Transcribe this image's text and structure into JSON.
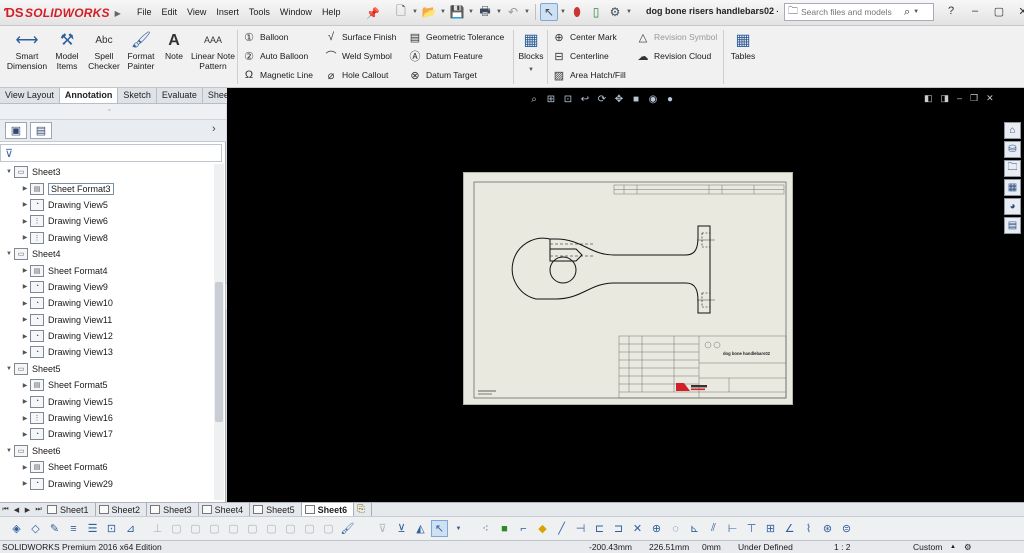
{
  "app": {
    "brand": "SOLIDWORKS",
    "doc_title": "dog bone risers handlebars02 - S..."
  },
  "menus": [
    "File",
    "Edit",
    "View",
    "Insert",
    "Tools",
    "Window",
    "Help"
  ],
  "search": {
    "placeholder": "Search files and models"
  },
  "ribbon": {
    "smart_dimension": "Smart Dimension",
    "model_items": "Model Items",
    "spell_checker": "Spell Checker",
    "format_painter": "Format Painter",
    "note": "Note",
    "linear_note_pattern": "Linear Note Pattern",
    "balloon": "Balloon",
    "auto_balloon": "Auto Balloon",
    "magnetic_line": "Magnetic Line",
    "surface_finish": "Surface Finish",
    "weld_symbol": "Weld Symbol",
    "hole_callout": "Hole Callout",
    "geometric_tolerance": "Geometric Tolerance",
    "datum_feature": "Datum Feature",
    "datum_target": "Datum Target",
    "blocks": "Blocks",
    "center_mark": "Center Mark",
    "centerline": "Centerline",
    "area_hatch_fill": "Area Hatch/Fill",
    "revision_symbol": "Revision Symbol",
    "revision_cloud": "Revision Cloud",
    "tables": "Tables"
  },
  "cm_tabs": [
    {
      "label": "View Layout",
      "active": false
    },
    {
      "label": "Annotation",
      "active": true
    },
    {
      "label": "Sketch",
      "active": false
    },
    {
      "label": "Evaluate",
      "active": false
    },
    {
      "label": "Sheet Format",
      "active": false
    }
  ],
  "tree": [
    {
      "label": "Sheet3",
      "level": 0,
      "icon": "sheet-icon"
    },
    {
      "label": "Sheet Format3",
      "level": 1,
      "icon": "sheet-format-icon",
      "selected": true
    },
    {
      "label": "Drawing View5",
      "level": 1,
      "icon": "drawing-view-icon"
    },
    {
      "label": "Drawing View6",
      "level": 1,
      "icon": "section-view-icon"
    },
    {
      "label": "Drawing View8",
      "level": 1,
      "icon": "section-view-icon"
    },
    {
      "label": "Sheet4",
      "level": 0,
      "icon": "sheet-icon"
    },
    {
      "label": "Sheet Format4",
      "level": 1,
      "icon": "sheet-format-icon"
    },
    {
      "label": "Drawing View9",
      "level": 1,
      "icon": "drawing-view-icon"
    },
    {
      "label": "Drawing View10",
      "level": 1,
      "icon": "drawing-view-icon"
    },
    {
      "label": "Drawing View11",
      "level": 1,
      "icon": "drawing-view-icon"
    },
    {
      "label": "Drawing View12",
      "level": 1,
      "icon": "drawing-view-icon"
    },
    {
      "label": "Drawing View13",
      "level": 1,
      "icon": "drawing-view-icon"
    },
    {
      "label": "Sheet5",
      "level": 0,
      "icon": "sheet-icon"
    },
    {
      "label": "Sheet Format5",
      "level": 1,
      "icon": "sheet-format-icon"
    },
    {
      "label": "Drawing View15",
      "level": 1,
      "icon": "drawing-view-icon"
    },
    {
      "label": "Drawing View16",
      "level": 1,
      "icon": "section-view-icon"
    },
    {
      "label": "Drawing View17",
      "level": 1,
      "icon": "drawing-view-icon"
    },
    {
      "label": "Sheet6",
      "level": 0,
      "icon": "sheet-icon"
    },
    {
      "label": "Sheet Format6",
      "level": 1,
      "icon": "sheet-format-icon"
    },
    {
      "label": "Drawing View29",
      "level": 1,
      "icon": "drawing-view-icon"
    }
  ],
  "sheet_tabs": [
    {
      "label": "Sheet1",
      "active": false
    },
    {
      "label": "Sheet2",
      "active": false
    },
    {
      "label": "Sheet3",
      "active": false
    },
    {
      "label": "Sheet4",
      "active": false
    },
    {
      "label": "Sheet5",
      "active": false
    },
    {
      "label": "Sheet6",
      "active": true
    }
  ],
  "drawing": {
    "title_block_name": "dog bone handlebars02"
  },
  "status": {
    "edition": "SOLIDWORKS Premium 2016 x64 Edition",
    "x": "-200.43mm",
    "y": "226.51mm",
    "z": "0mm",
    "state": "Under Defined",
    "scale": "1 : 2",
    "units": "Custom"
  },
  "colors": {
    "brand_red": "#d12027",
    "graphics_bg": "#000000",
    "sheet_bg": "#e9e9e0"
  }
}
